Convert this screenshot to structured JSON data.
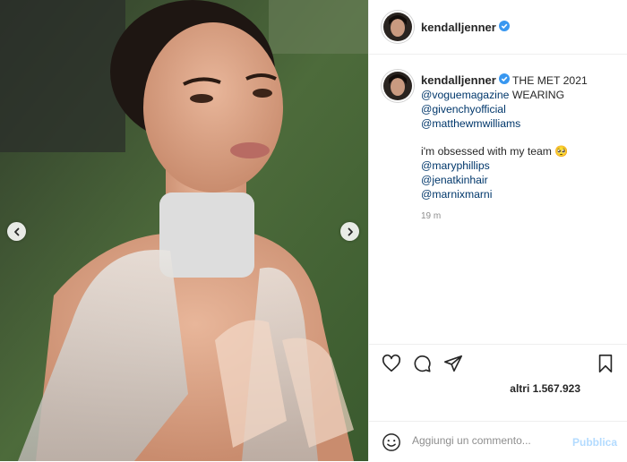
{
  "post": {
    "username": "kendalljenner",
    "verified_icon": "verified-badge-icon",
    "photo_alt": "Kendall Jenner at the Met Gala 2021"
  },
  "caption": {
    "username": "kendalljenner",
    "title": "THE MET 2021",
    "mention_1": "@voguemagazine",
    "text_1": "WEARING",
    "mention_2": "@givenchyofficial",
    "mention_3": "@matthewmwilliams",
    "line_2": "i'm obsessed with my team 🥺",
    "mention_4": "@maryphillips",
    "mention_5": "@jenatkinhair",
    "mention_6": "@marnixmarni"
  },
  "time": "19 m",
  "likes": "altri 1.567.923",
  "comment": {
    "placeholder": "Aggiungi un commento...",
    "publish_label": "Pubblica"
  },
  "colors": {
    "link": "#00376b",
    "verified": "#3897f0",
    "publish_disabled": "#b3dbff",
    "text": "#262626",
    "muted": "#8e8e8e"
  },
  "icons": [
    "chevron-left-icon",
    "chevron-right-icon",
    "heart-icon",
    "comment-icon",
    "share-icon",
    "bookmark-icon",
    "emoji-icon",
    "verified-badge-icon"
  ]
}
